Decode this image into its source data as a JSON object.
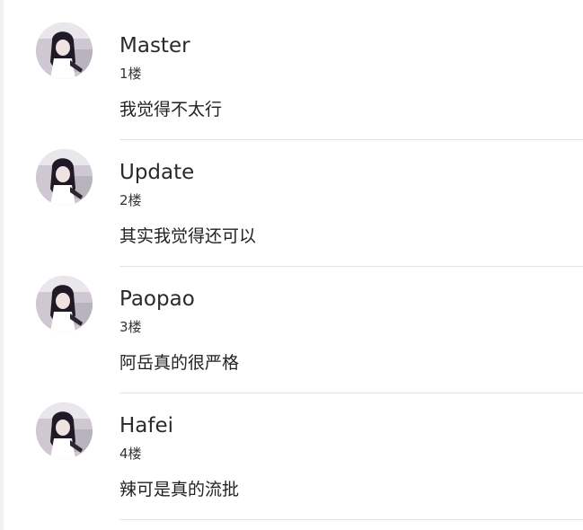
{
  "comments": [
    {
      "name": "Master",
      "floor": "1楼",
      "text": "我觉得不太行",
      "avatar_icon": "user-avatar-photo"
    },
    {
      "name": "Update",
      "floor": "2楼",
      "text": "其实我觉得还可以",
      "avatar_icon": "user-avatar-photo"
    },
    {
      "name": "Paopao",
      "floor": "3楼",
      "text": "阿岳真的很严格",
      "avatar_icon": "user-avatar-photo"
    },
    {
      "name": "Hafei",
      "floor": "4楼",
      "text": "辣可是真的流批",
      "avatar_icon": "user-avatar-photo"
    }
  ],
  "colors": {
    "divider": "#e3e3e3",
    "name_text": "#2a2a2a",
    "body_text": "#222222"
  }
}
